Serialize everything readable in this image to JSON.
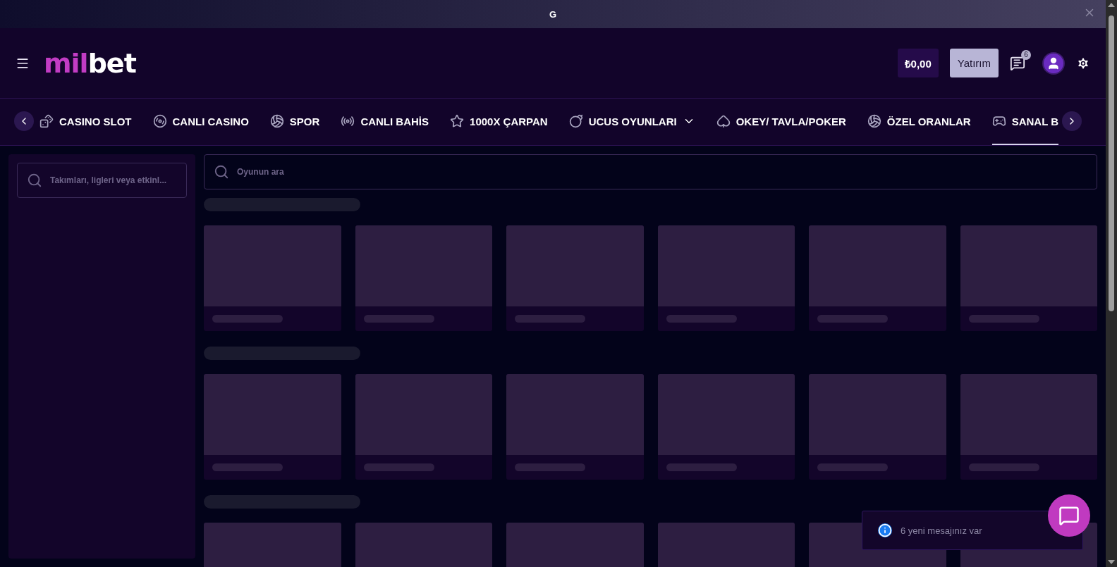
{
  "top_banner": {
    "title": "G"
  },
  "header": {
    "logo": {
      "accent": "mil",
      "rest": "bet"
    },
    "balance": "₺0,00",
    "deposit_button": "Yatırım",
    "messages_badge": "6"
  },
  "nav": [
    {
      "label": "CASINO SLOT",
      "selected": false,
      "dropdown": false
    },
    {
      "label": "CANLI CASINO",
      "selected": false,
      "dropdown": false
    },
    {
      "label": "SPOR",
      "selected": false,
      "dropdown": false
    },
    {
      "label": "CANLI BAHİS",
      "selected": false,
      "dropdown": false
    },
    {
      "label": "1000X ÇARPAN",
      "selected": false,
      "dropdown": false
    },
    {
      "label": "UCUS OYUNLARI",
      "selected": false,
      "dropdown": true
    },
    {
      "label": "OKEY/ TAVLA/POKER",
      "selected": false,
      "dropdown": false
    },
    {
      "label": "ÖZEL ORANLAR",
      "selected": false,
      "dropdown": false
    },
    {
      "label": "SANAL B",
      "selected": true,
      "dropdown": false
    }
  ],
  "sidebar": {
    "search": {
      "placeholder": "Takımları, ligleri veya etkinl..."
    }
  },
  "main": {
    "search": {
      "placeholder": "Oyunun ara"
    }
  },
  "toast": {
    "message": "6 yeni mesajınız var"
  }
}
